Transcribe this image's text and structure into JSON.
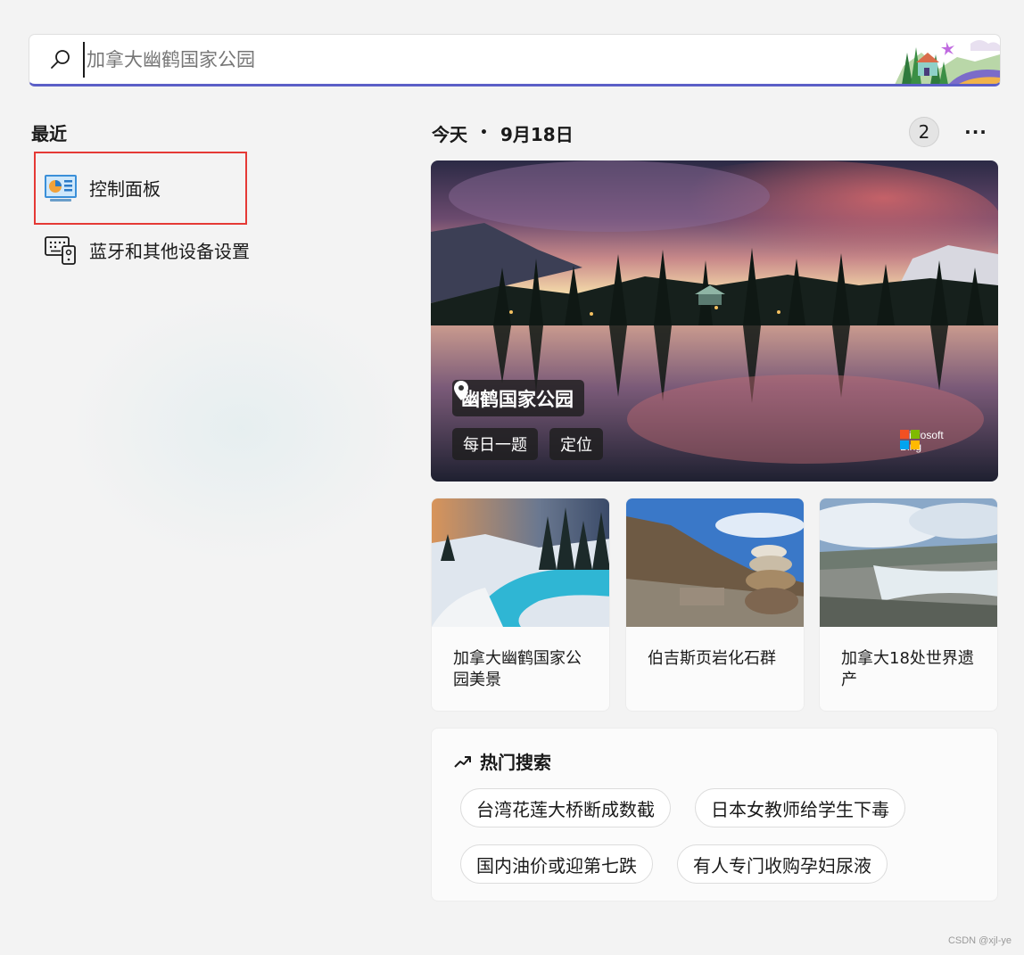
{
  "search": {
    "placeholder": "加拿大幽鹤国家公园"
  },
  "recent": {
    "heading": "最近",
    "items": [
      {
        "label": "控制面板",
        "icon": "control-panel-icon"
      },
      {
        "label": "蓝牙和其他设备设置",
        "icon": "bluetooth-devices-icon"
      }
    ]
  },
  "today": {
    "label": "今天",
    "separator": "•",
    "date": "9月18日",
    "count": "2",
    "more_icon": "more-options-icon",
    "more_label": "···"
  },
  "hero": {
    "location": "幽鹤国家公园",
    "chips": [
      "每日一题",
      "定位"
    ],
    "brand_line1": "Microsoft",
    "brand_line2": "Bing"
  },
  "cards": [
    {
      "title": "加拿大幽鹤国家公园美景"
    },
    {
      "title": "伯吉斯页岩化石群"
    },
    {
      "title": "加拿大18处世界遗产"
    }
  ],
  "trending": {
    "heading": "热门搜索",
    "items": [
      "台湾花莲大桥断成数截",
      "日本女教师给学生下毒",
      "国内油价或迎第七跌",
      "有人专门收购孕妇尿液"
    ]
  },
  "watermark": "CSDN @xjl-ye",
  "colors": {
    "accent": "#5b5fc7",
    "highlight": "#e53935",
    "background": "#f3f3f3"
  }
}
